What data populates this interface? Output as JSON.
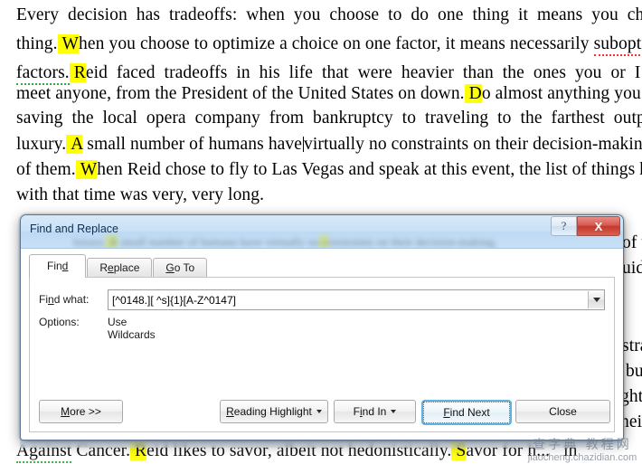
{
  "document": {
    "lines": [
      "Every decision has tradeoffs: when you choose to do one thing it means you choose not",
      "thing. When you choose to optimize a choice on one factor, it means necessarily suboptimi",
      "factors. Reid faced tradeoffs in his life that were heavier than the ones you or I face. Ima",
      "meet anyone, from the President of the United States on down. Do almost anything you can",
      "saving the local opera company from bankruptcy to traveling to the farthest outposts o",
      "luxury. A small number of humans have virtually no constraints on their decision-making,",
      "of them. When Reid chose to fly to Las Vegas and speak at this event, the list of things he",
      "with that time was very, very long."
    ],
    "occluded_line": "Against Cancer. Reid likes to savor, albeit not hedonistically. Savor for h...",
    "right_margin_fragments": [
      "of v",
      "uid",
      "stra",
      "bu",
      "ght",
      "hei",
      "in"
    ],
    "highlight_color": "#ffff00"
  },
  "dialog": {
    "title": "Find and Replace",
    "caption": {
      "help_label": "?",
      "close_label": "X",
      "help_icon": "question-mark-icon",
      "close_icon": "close-x-icon"
    },
    "tabs": [
      {
        "label": "Find",
        "active": true
      },
      {
        "label": "Replace",
        "active": false
      },
      {
        "label": "Go To",
        "active": false
      }
    ],
    "find_what": {
      "label": "Find what:",
      "value": "[^0148.][ ^s]{1}[A-Z^0147]",
      "placeholder": "",
      "dropdown_icon": "chevron-down-icon"
    },
    "options": {
      "label": "Options:",
      "value": "Use Wildcards"
    },
    "buttons": [
      {
        "label": "More >>",
        "has_menu": false,
        "default": false
      },
      {
        "label": "Reading Highlight",
        "has_menu": true,
        "default": false
      },
      {
        "label": "Find In",
        "has_menu": true,
        "default": false
      },
      {
        "label": "Find Next",
        "has_menu": false,
        "default": true
      },
      {
        "label": "Close",
        "has_menu": false,
        "default": false
      }
    ]
  },
  "watermark": {
    "top": "查字典 教程网",
    "bottom": "jiaocheng.chazidian.com"
  }
}
